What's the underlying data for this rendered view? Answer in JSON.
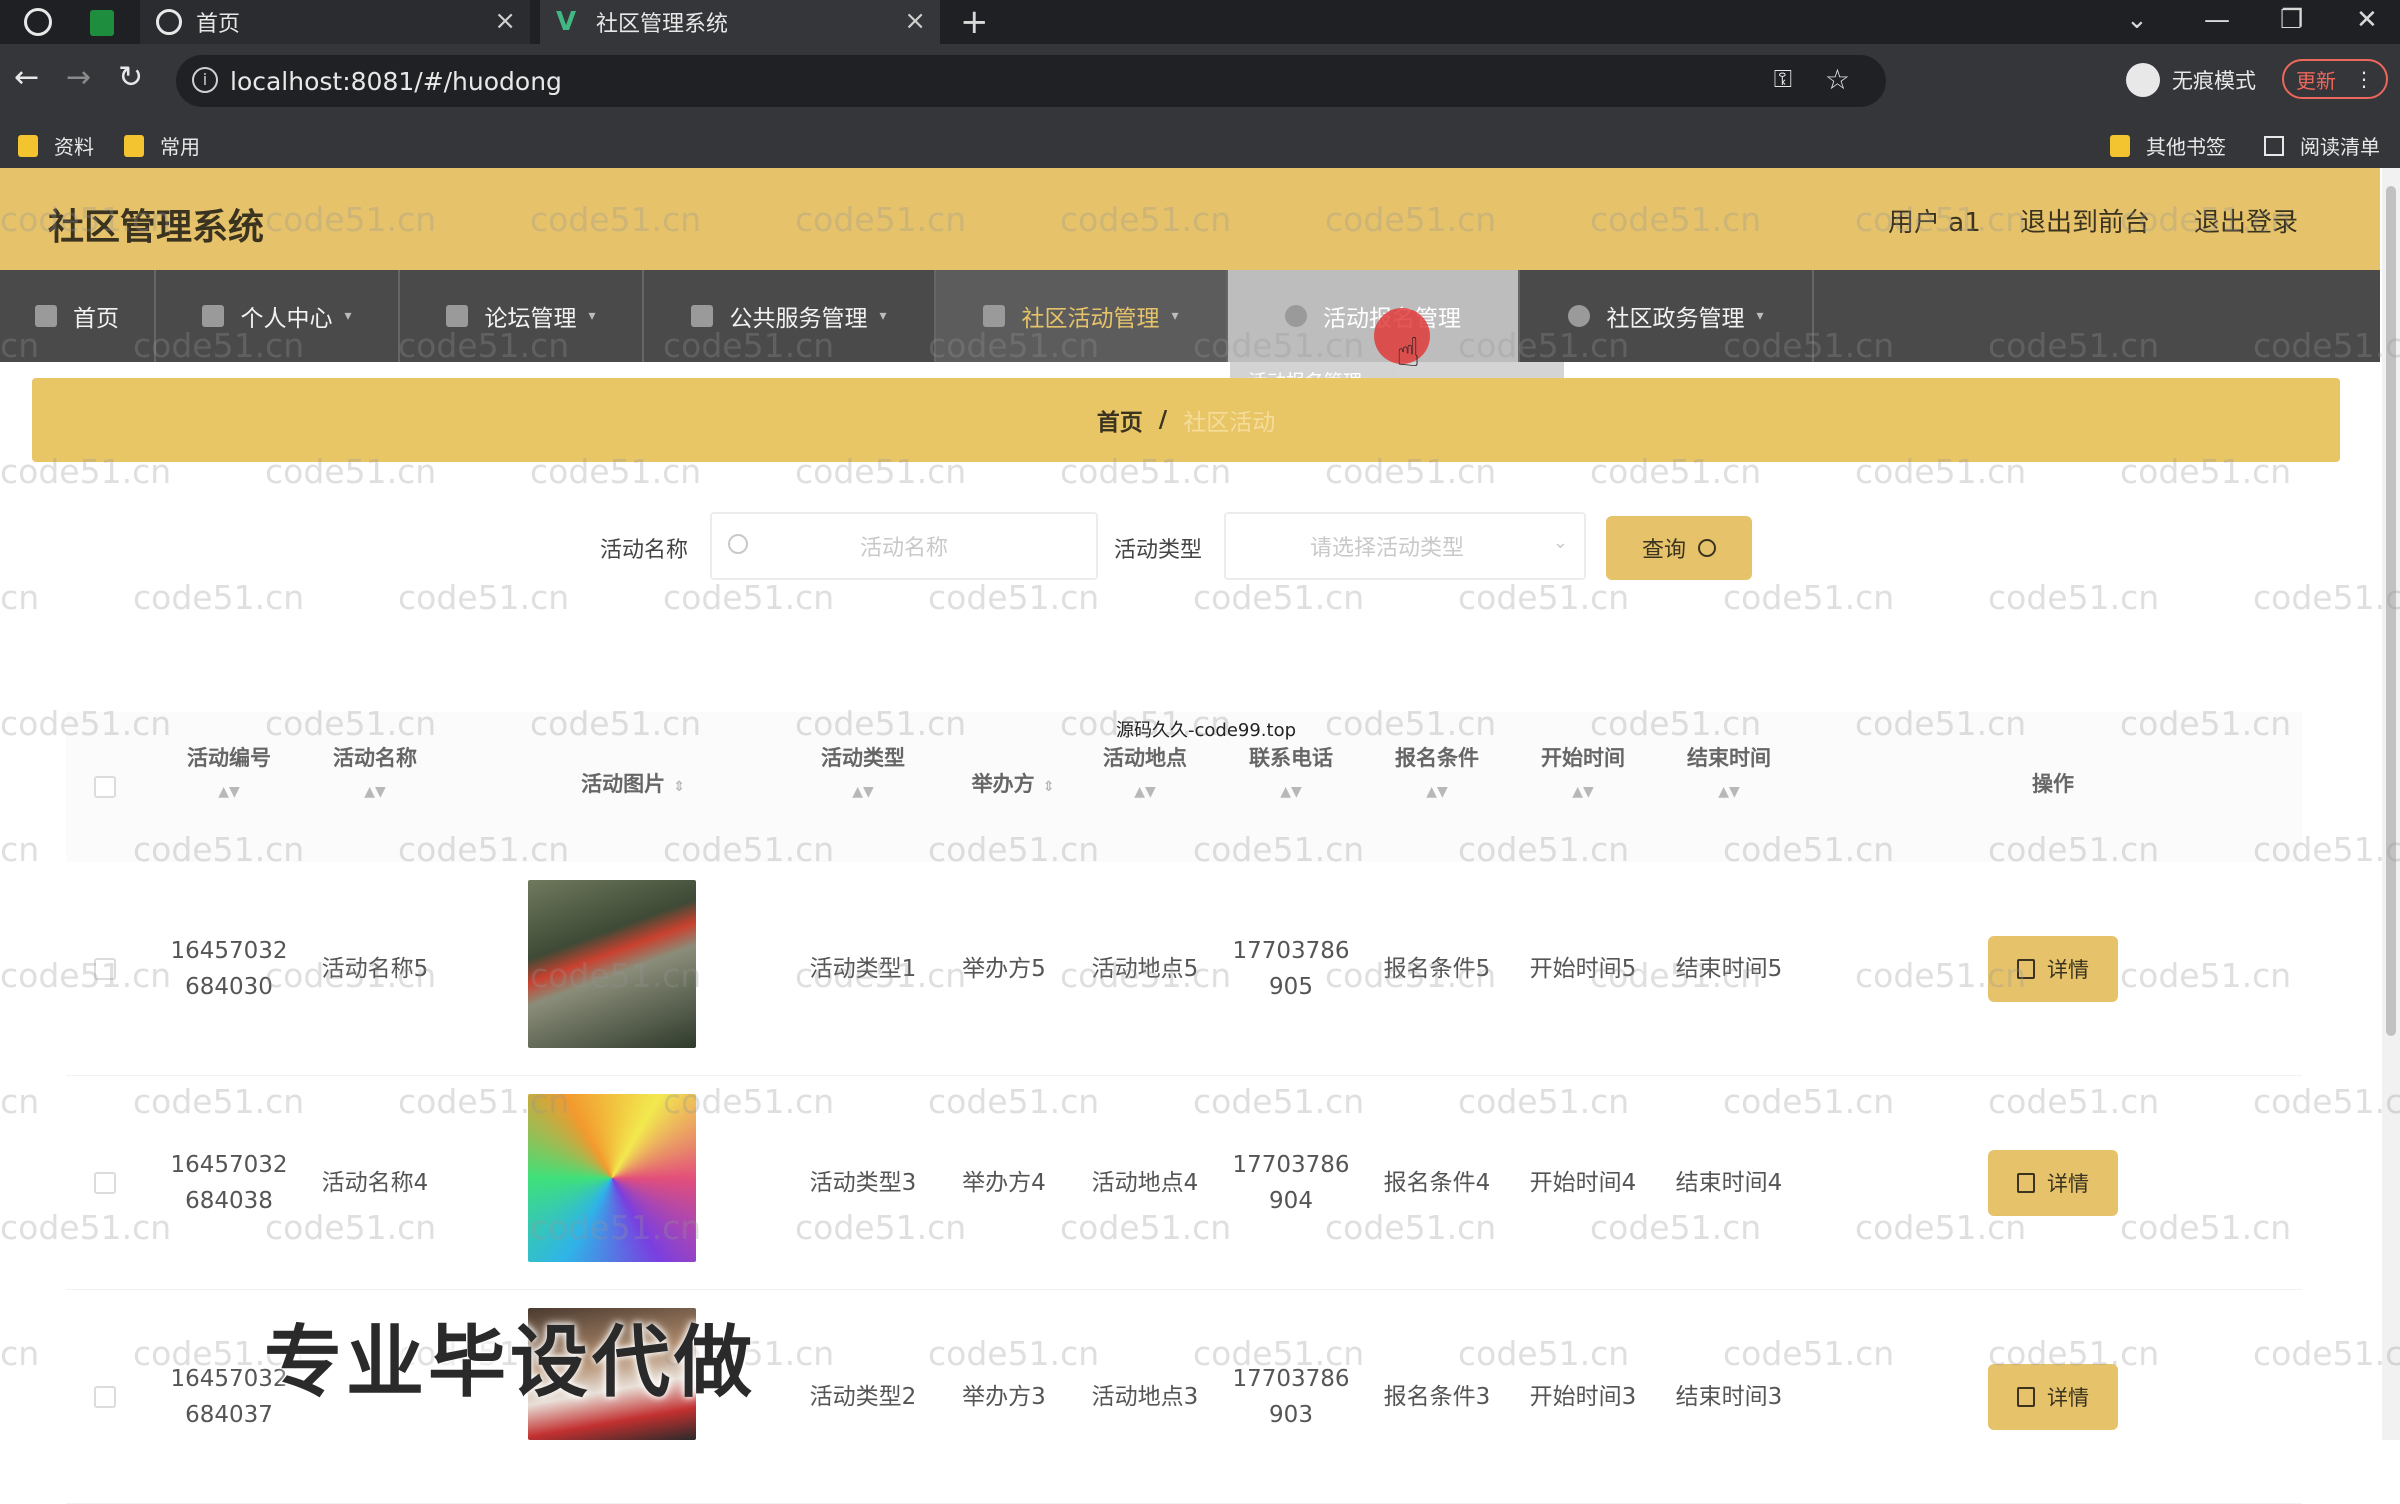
{
  "browser": {
    "tabs": [
      {
        "title": "首页"
      },
      {
        "title": "社区管理系统"
      }
    ],
    "new_tab": "+",
    "url": "localhost:8081/#/huodong",
    "incognito_label": "无痕模式",
    "update_label": "更新",
    "bookmarks": [
      "资料",
      "常用"
    ],
    "bookmarks_right": [
      "其他书签",
      "阅读清单"
    ]
  },
  "header": {
    "title": "社区管理系统",
    "user": "用户 a1",
    "back_to_front": "退出到前台",
    "logout": "退出登录"
  },
  "menu": {
    "items": [
      {
        "label": "首页",
        "icon": "home-icon"
      },
      {
        "label": "个人中心",
        "icon": "user-icon"
      },
      {
        "label": "论坛管理",
        "icon": "forum-icon"
      },
      {
        "label": "公共服务管理",
        "icon": "service-icon"
      },
      {
        "label": "社区活动管理",
        "icon": "activity-icon"
      },
      {
        "label": "活动报名管理",
        "icon": "signup-icon"
      },
      {
        "label": "社区政务管理",
        "icon": "clock-icon"
      }
    ],
    "submenu_item": "活动报名管理"
  },
  "breadcrumb": {
    "home": "首页",
    "separator": "/",
    "current": "社区活动"
  },
  "search": {
    "name_label": "活动名称",
    "name_placeholder": "活动名称",
    "type_label": "活动类型",
    "type_placeholder": "请选择活动类型",
    "query_button": "查询"
  },
  "table": {
    "columns": [
      "活动编号",
      "活动名称",
      "活动图片",
      "活动类型",
      "举办方",
      "活动地点",
      "联系电话",
      "报名条件",
      "开始时间",
      "结束时间",
      "操作"
    ],
    "rows": [
      {
        "id_line1": "16457032",
        "id_line2": "684030",
        "name": "活动名称5",
        "type": "活动类型1",
        "host": "举办方5",
        "place": "活动地点5",
        "phone_line1": "17703786",
        "phone_line2": "905",
        "cond": "报名条件5",
        "start": "开始时间5",
        "end": "结束时间5",
        "action": "详情"
      },
      {
        "id_line1": "16457032",
        "id_line2": "684038",
        "name": "活动名称4",
        "type": "活动类型3",
        "host": "举办方4",
        "place": "活动地点4",
        "phone_line1": "17703786",
        "phone_line2": "904",
        "cond": "报名条件4",
        "start": "开始时间4",
        "end": "结束时间4",
        "action": "详情"
      },
      {
        "id_line1": "16457032",
        "id_line2": "684037",
        "name": "",
        "type": "活动类型2",
        "host": "举办方3",
        "place": "活动地点3",
        "phone_line1": "17703786",
        "phone_line2": "903",
        "cond": "报名条件3",
        "start": "开始时间3",
        "end": "结束时间3",
        "action": "详情"
      }
    ]
  },
  "overlays": {
    "watermark_text": "code51.cn",
    "source_text": "源码久久-code99.top",
    "promo_text": "专业毕设代做"
  },
  "colors": {
    "brand": "#e6c36a",
    "menu_bg": "#4a4a4a",
    "browser_bg": "#35363a"
  }
}
